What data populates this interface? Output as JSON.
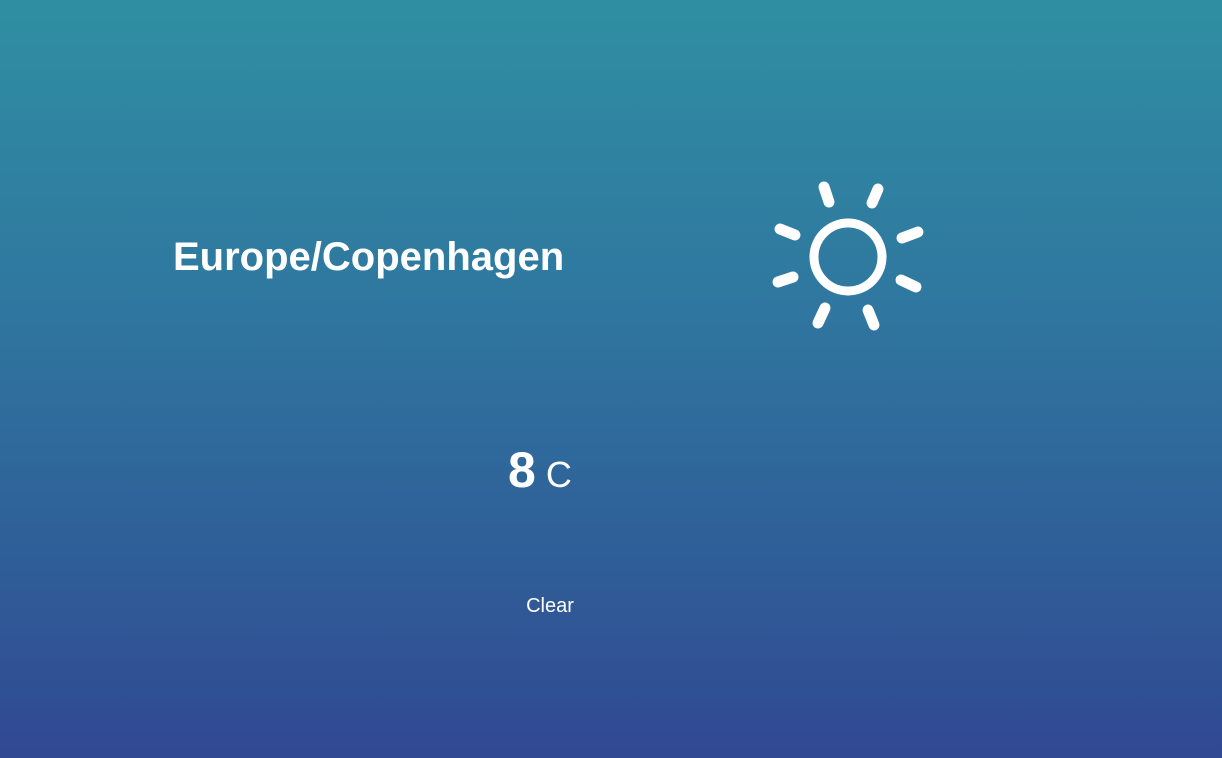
{
  "location": {
    "timezone": "Europe/Copenhagen"
  },
  "weather": {
    "icon": "sun-icon",
    "temperature": "8",
    "unit": "C",
    "condition": "Clear"
  },
  "colors": {
    "gradient_top": "#2f8fa2",
    "gradient_bottom": "#314893",
    "text": "#ffffff"
  }
}
